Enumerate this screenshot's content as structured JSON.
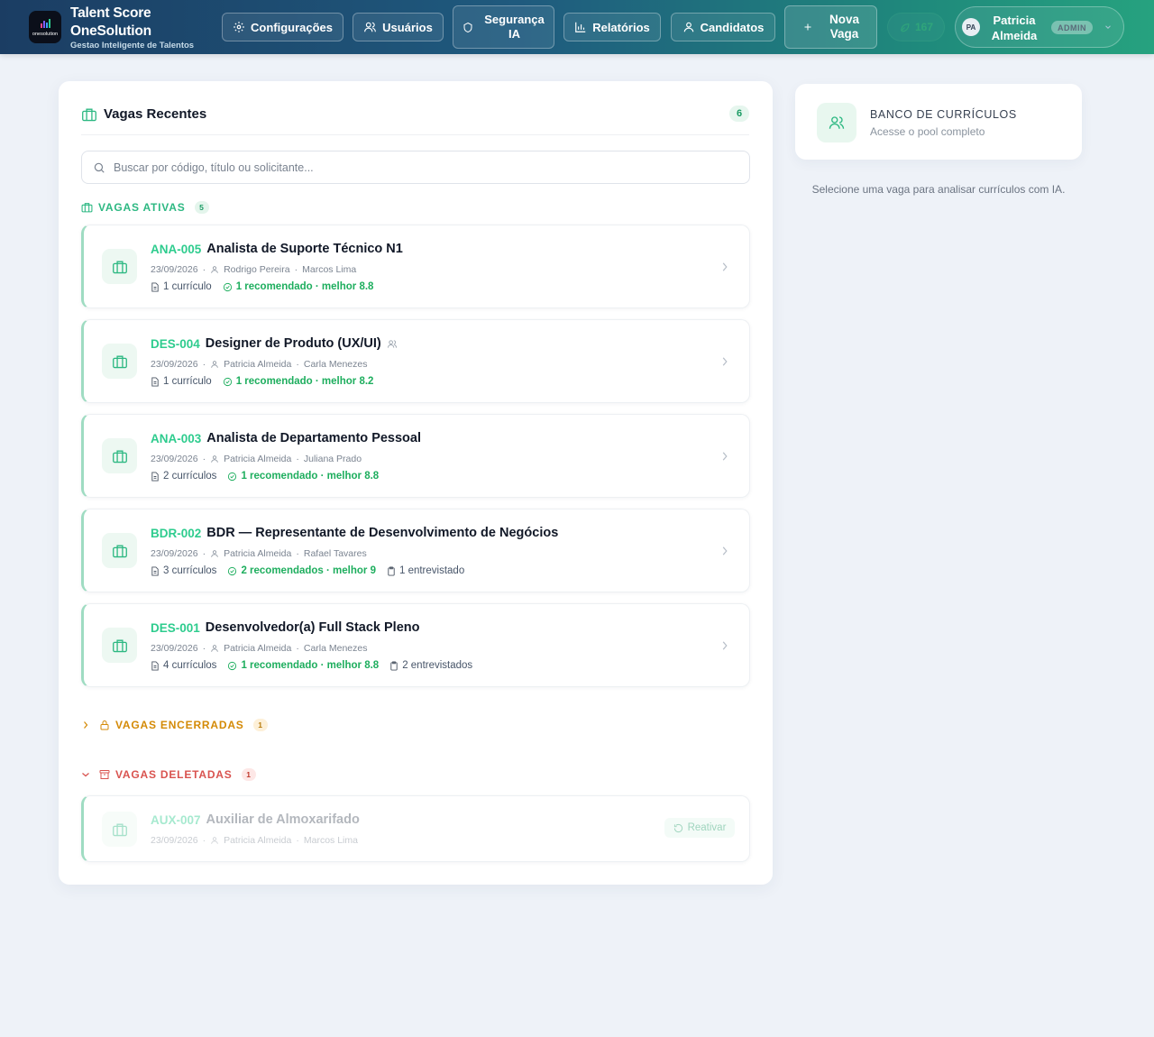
{
  "app": {
    "brand_line1": "Talent Score",
    "brand_line2": "OneSolution",
    "tagline": "Gestao Inteligente de Talentos",
    "logo_text": "onesolution"
  },
  "nav": {
    "settings": "Configurações",
    "users": "Usuários",
    "security_line1": "Segurança",
    "security_line2": "IA",
    "reports": "Relatórios",
    "candidates": "Candidatos",
    "new_job_line1": "Nova",
    "new_job_line2": "Vaga",
    "credits": "167"
  },
  "user": {
    "initials": "PA",
    "first_name": "Patricia",
    "last_name": "Almeida",
    "role": "ADMIN"
  },
  "jobs_panel": {
    "title": "Vagas Recentes",
    "count": "6",
    "search_placeholder": "Buscar por código, título ou solicitante...",
    "active_label": "VAGAS ATIVAS",
    "active_count": "5",
    "closed_label": "VAGAS ENCERRADAS",
    "closed_count": "1",
    "deleted_label": "VAGAS DELETADAS",
    "deleted_count": "1"
  },
  "active_jobs": [
    {
      "code": "ANA-005",
      "title": "Analista de Suporte Técnico N1",
      "date": "23/09/2026",
      "requester": "Rodrigo Pereira",
      "recruiter": "Marcos Lima",
      "resumes": "1 currículo",
      "recommended": "1 recomendado · melhor 8.8",
      "interviewed": ""
    },
    {
      "code": "DES-004",
      "title": "Designer de Produto (UX/UI)",
      "date": "23/09/2026",
      "requester": "Patricia Almeida",
      "recruiter": "Carla Menezes",
      "resumes": "1 currículo",
      "recommended": "1 recomendado · melhor 8.2",
      "interviewed": ""
    },
    {
      "code": "ANA-003",
      "title": "Analista de Departamento Pessoal",
      "date": "23/09/2026",
      "requester": "Patricia Almeida",
      "recruiter": "Juliana Prado",
      "resumes": "2 currículos",
      "recommended": "1 recomendado · melhor 8.8",
      "interviewed": ""
    },
    {
      "code": "BDR-002",
      "title": "BDR — Representante de Desenvolvimento de Negócios",
      "date": "23/09/2026",
      "requester": "Patricia Almeida",
      "recruiter": "Rafael Tavares",
      "resumes": "3 currículos",
      "recommended": "2 recomendados · melhor 9",
      "interviewed": "1 entrevistado"
    },
    {
      "code": "DES-001",
      "title": "Desenvolvedor(a) Full Stack Pleno",
      "date": "23/09/2026",
      "requester": "Patricia Almeida",
      "recruiter": "Carla Menezes",
      "resumes": "4 currículos",
      "recommended": "1 recomendado · melhor 8.8",
      "interviewed": "2 entrevistados"
    }
  ],
  "deleted_jobs": [
    {
      "code": "AUX-007",
      "title": "Auxiliar de Almoxarifado",
      "date": "23/09/2026",
      "requester": "Patricia Almeida",
      "recruiter": "Marcos Lima",
      "action": "Reativar"
    }
  ],
  "resume_bank": {
    "title": "BANCO DE CURRÍCULOS",
    "subtitle": "Acesse o pool completo"
  },
  "hint": "Selecione uma vaga para analisar currículos com IA.",
  "colors": {
    "accent": "#2ecc8e",
    "recommended": "#1eae5e",
    "closed": "#d48a06",
    "deleted": "#d9534f"
  }
}
